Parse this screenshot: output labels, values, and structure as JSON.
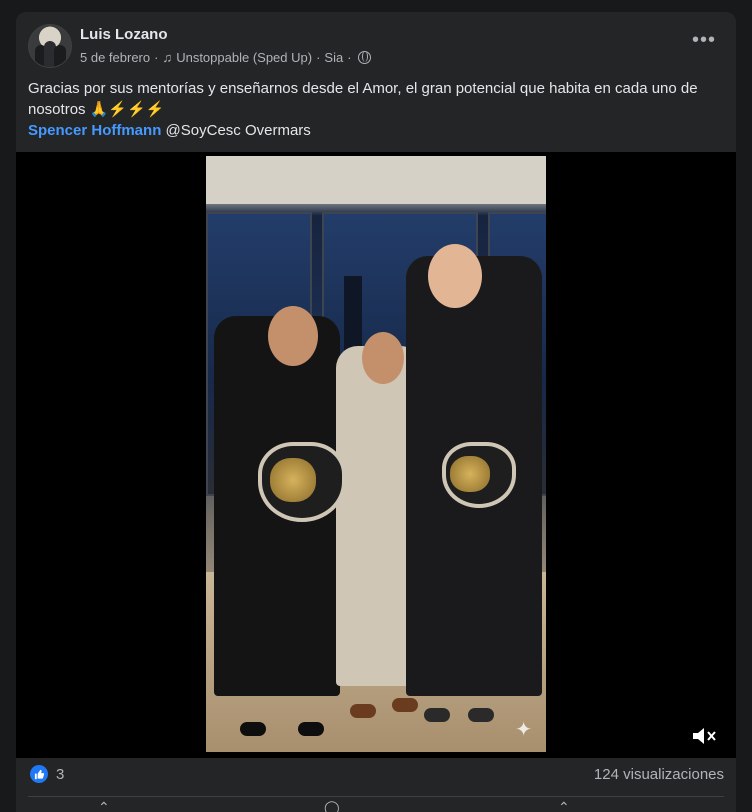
{
  "post": {
    "author": "Luis Lozano",
    "date": "5 de febrero",
    "music_separator": "·",
    "music": "Unstoppable (Sped Up)",
    "location_separator": "·",
    "location": "Sia",
    "location_trailing_separator": "·",
    "text_line": "Gracias por sus mentorías y enseñarnos desde el Amor, el gran potencial que habita en cada uno de nosotros",
    "emojis": "🙏⚡⚡⚡",
    "mention": "Spencer Hoffmann",
    "tag": "@SoyCesc Overmars"
  },
  "footer": {
    "like_count": "3",
    "views": "124 visualizaciones"
  },
  "colors": {
    "background": "#18191a",
    "card": "#242526",
    "mention": "#4599ff",
    "like": "#2078f4"
  }
}
